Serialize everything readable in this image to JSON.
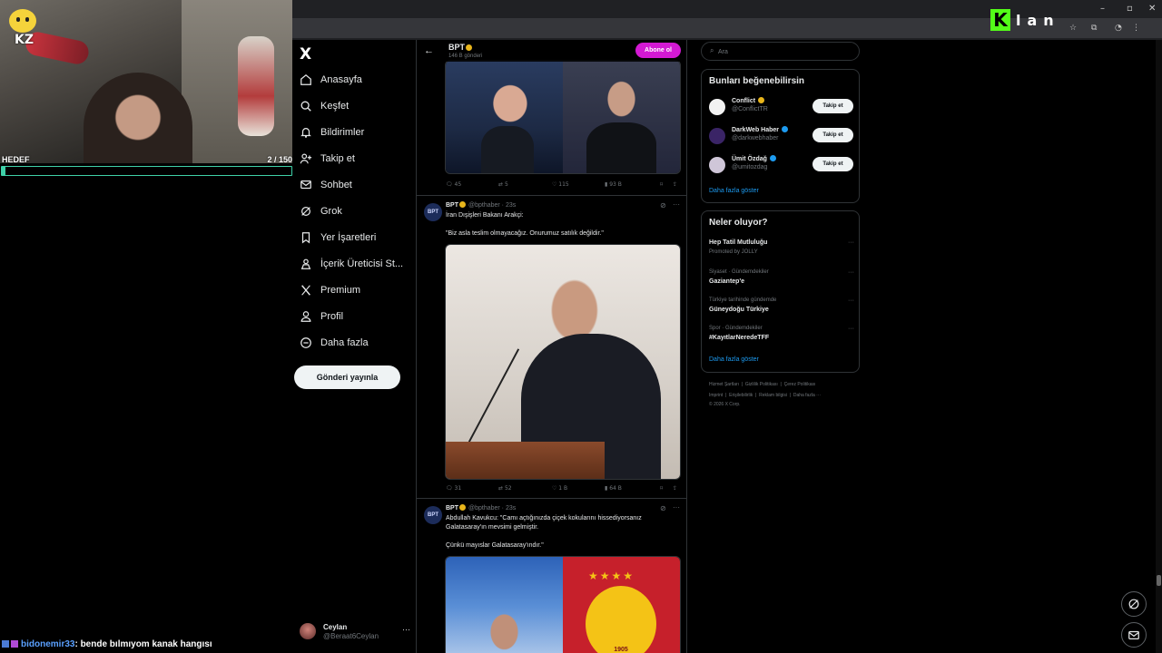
{
  "overlay": {
    "badge": "KZ",
    "goal_label": "HEDEF",
    "goal_current": "2",
    "goal_sep": " / ",
    "goal_total": "150",
    "goal_progress": 0.013,
    "goal_color": "#3fd0a8",
    "chat_user": "bidonemir33",
    "chat_message": ": bende bılmıyom kanak hangısı",
    "kick_letters": "lan",
    "kick_color": "#53fc18"
  },
  "nav": {
    "logo": "X",
    "items": [
      {
        "label": "Anasayfa",
        "icon": "home-icon"
      },
      {
        "label": "Keşfet",
        "icon": "search-icon"
      },
      {
        "label": "Bildirimler",
        "icon": "bell-icon"
      },
      {
        "label": "Takip et",
        "icon": "follow-icon"
      },
      {
        "label": "Sohbet",
        "icon": "chat-icon"
      },
      {
        "label": "Grok",
        "icon": "grok-icon"
      },
      {
        "label": "Yer İşaretleri",
        "icon": "bookmark-icon"
      },
      {
        "label": "İçerik Üreticisi St...",
        "icon": "creator-icon"
      },
      {
        "label": "Premium",
        "icon": "x-icon"
      },
      {
        "label": "Profil",
        "icon": "profile-icon"
      },
      {
        "label": "Daha fazla",
        "icon": "more-icon"
      }
    ],
    "post_button": "Gönderi yayınla",
    "account": {
      "name": "Ceylan",
      "handle": "@Beraat6Ceylan"
    }
  },
  "header": {
    "name": "BPT",
    "post_count": "146 B gönderi",
    "subscribe": "Abone ol",
    "accent": "#d319d3"
  },
  "tweets": [
    {
      "actions": {
        "replies": "45",
        "reposts": "5",
        "likes": "115",
        "views": "93 B"
      }
    },
    {
      "avatar": "BPT",
      "name": "BPT",
      "handle": "@bpthaber · 23s",
      "lines": [
        "İran Dışişleri Bakanı Arakçi:",
        "",
        "\"Biz asla teslim olmayacağız. Onurumuz satılık değildir.\""
      ],
      "actions": {
        "replies": "31",
        "reposts": "52",
        "likes": "1 B",
        "views": "64 B"
      }
    },
    {
      "avatar": "BPT",
      "name": "BPT",
      "handle": "@bpthaber · 23s",
      "lines": [
        "Abdullah Kavukcu: \"Camı açtığınızda çiçek kokularını hissediyorsanız",
        "Galatasaray'ın mevsimi gelmiştir.",
        "",
        "Çünkü mayıslar Galatasaray'ındır.\""
      ],
      "media_badge": "1905"
    }
  ],
  "right": {
    "search_placeholder": "Ara",
    "who_title": "Bunları beğenebilirsin",
    "who": [
      {
        "name": "Conflict",
        "handle": "@ConflictTR",
        "button": "Takip et",
        "badge": "gold"
      },
      {
        "name": "DarkWeb Haber",
        "handle": "@darkwebhaber",
        "button": "Takip et",
        "badge": "blue"
      },
      {
        "name": "Ümit Özdağ",
        "handle": "@umitozdag",
        "button": "Takip et",
        "badge": "blue"
      }
    ],
    "show_more": "Daha fazla göster",
    "trends_title": "Neler oluyor?",
    "promo": {
      "title": "Hep Tatil Mutluluğu",
      "meta": "Promoted by JOLLY"
    },
    "trends": [
      {
        "meta": "Siyaset · Gündemdekiler",
        "title": "Gaziantep'e"
      },
      {
        "meta": "Türkiye tarihinde gündemde",
        "title": "Güneydoğu Türkiye"
      },
      {
        "meta": "Spor · Gündemdekiler",
        "title": "#KayıtlarNeredeTFF"
      }
    ],
    "footer": {
      "line1": [
        "Hizmet Şartları",
        "Gizlilik Politikası",
        "Çerez Politikası"
      ],
      "line2": [
        "Imprint",
        "Erişilebilirlik",
        "Reklam bilgisi",
        "Daha fazla ···"
      ],
      "copyright": "© 2026 X Corp."
    }
  }
}
